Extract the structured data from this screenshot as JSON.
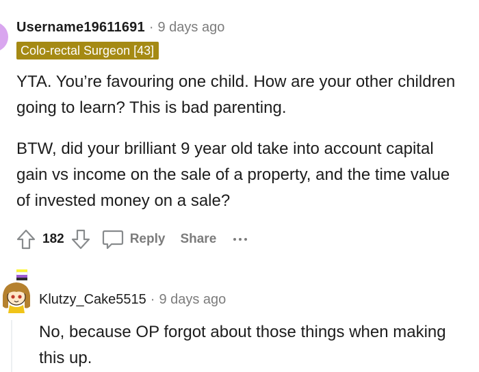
{
  "comment": {
    "username": "Username19611691",
    "separator": "·",
    "time": "9 days ago",
    "flair": "Colo-rectal Surgeon [43]",
    "flair_color": "#a58a14",
    "paragraphs": [
      "YTA. You’re favouring one child. How are your other children going to learn? This is bad parenting.",
      "BTW, did your brilliant 9 year old take into account capital gain vs income on the sale of a property, and the time value of invested money on a sale?"
    ],
    "actions": {
      "upvote_icon": "arrow-up-icon",
      "score": "182",
      "downvote_icon": "arrow-down-icon",
      "reply_icon": "speech-bubble-icon",
      "reply_label": "Reply",
      "share_label": "Share",
      "more_icon": "ellipsis-icon"
    }
  },
  "reply": {
    "username": "Klutzy_Cake5515",
    "separator": "·",
    "time": "9 days ago",
    "text": "No, because OP forgot about those things when making this up."
  },
  "colors": {
    "text": "#1c1c1c",
    "muted": "#7c7c7c",
    "avatar_pink": "#d9a6ef",
    "thread_line": "#edeff1"
  }
}
